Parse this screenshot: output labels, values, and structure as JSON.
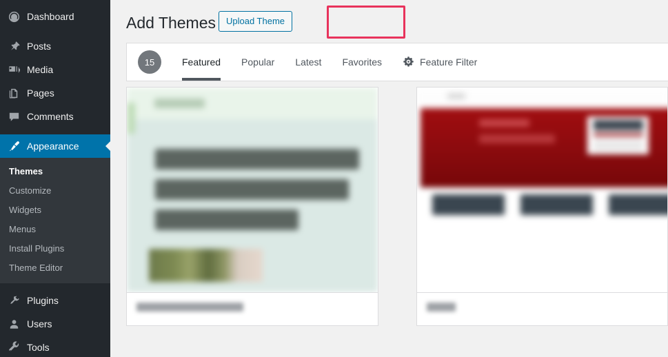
{
  "sidebar": {
    "items": [
      {
        "label": "Dashboard",
        "icon": "dashboard-icon",
        "current": false
      },
      {
        "label": "Posts",
        "icon": "pin-icon",
        "current": false
      },
      {
        "label": "Media",
        "icon": "media-icon",
        "current": false
      },
      {
        "label": "Pages",
        "icon": "pages-icon",
        "current": false
      },
      {
        "label": "Comments",
        "icon": "comments-icon",
        "current": false
      },
      {
        "label": "Appearance",
        "icon": "appearance-brush-icon",
        "current": true
      },
      {
        "label": "Plugins",
        "icon": "plugins-plug-icon",
        "current": false
      },
      {
        "label": "Users",
        "icon": "users-icon",
        "current": false
      },
      {
        "label": "Tools",
        "icon": "tools-wrench-icon",
        "current": false
      }
    ],
    "submenu": [
      {
        "label": "Themes",
        "active": true
      },
      {
        "label": "Customize",
        "active": false
      },
      {
        "label": "Widgets",
        "active": false
      },
      {
        "label": "Menus",
        "active": false
      },
      {
        "label": "Install Plugins",
        "active": false
      },
      {
        "label": "Theme Editor",
        "active": false
      }
    ]
  },
  "header": {
    "title": "Add Themes",
    "upload_button_label": "Upload Theme",
    "annotation_color": "#e8335c"
  },
  "theme_navbar": {
    "count": "15",
    "tabs": [
      {
        "label": "Featured",
        "active": true
      },
      {
        "label": "Popular",
        "active": false
      },
      {
        "label": "Latest",
        "active": false
      },
      {
        "label": "Favorites",
        "active": false
      }
    ],
    "feature_filter_label": "Feature Filter",
    "feature_filter_icon": "gear-icon"
  },
  "themes": [
    {
      "preview": "blurred-article-theme-preview",
      "name_blurred": true
    },
    {
      "preview": "blurred-red-banner-theme-preview",
      "name_blurred": true
    }
  ],
  "colors": {
    "admin_menu_bg": "#23282d",
    "admin_submenu_bg": "#32373c",
    "accent_blue": "#0073aa",
    "link_blue": "#0071a1",
    "page_bg": "#f1f1f1",
    "badge_gray": "#72777c"
  }
}
